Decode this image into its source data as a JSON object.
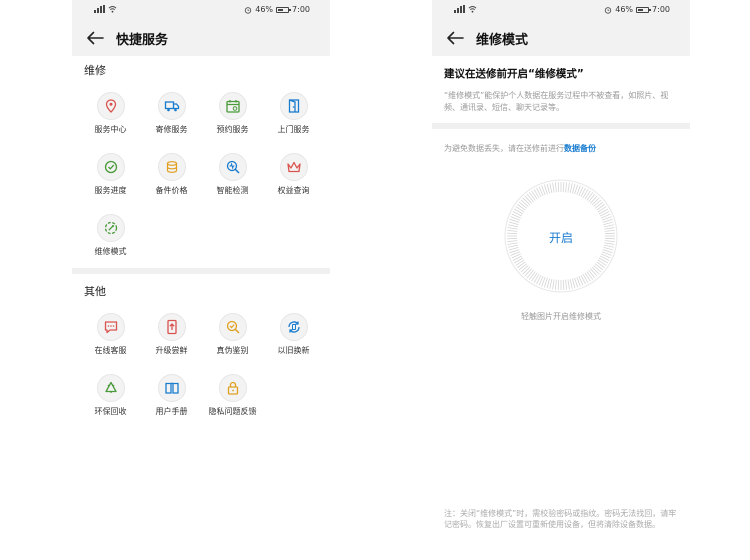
{
  "status_bar": {
    "battery": "46%",
    "time": "7:00"
  },
  "left_screen": {
    "title": "快捷服务",
    "sections": [
      {
        "label": "维修",
        "items": [
          {
            "label": "服务中心",
            "icon": "location-pin-icon",
            "color": "#d9534f"
          },
          {
            "label": "寄修服务",
            "icon": "truck-icon",
            "color": "#1a7ccf"
          },
          {
            "label": "预约服务",
            "icon": "calendar-icon",
            "color": "#4a9a3a"
          },
          {
            "label": "上门服务",
            "icon": "door-icon",
            "color": "#1a7ccf"
          },
          {
            "label": "服务进度",
            "icon": "progress-icon",
            "color": "#4a9a3a"
          },
          {
            "label": "备件价格",
            "icon": "coins-icon",
            "color": "#e0a020"
          },
          {
            "label": "智能检测",
            "icon": "detect-icon",
            "color": "#1a7ccf"
          },
          {
            "label": "权益查询",
            "icon": "crown-icon",
            "color": "#d9534f"
          },
          {
            "label": "维修模式",
            "icon": "repair-mode-icon",
            "color": "#4a9a3a"
          }
        ]
      },
      {
        "label": "其他",
        "items": [
          {
            "label": "在线客服",
            "icon": "chat-icon",
            "color": "#d9534f"
          },
          {
            "label": "升级尝鲜",
            "icon": "upgrade-icon",
            "color": "#d9534f"
          },
          {
            "label": "真伪鉴别",
            "icon": "authenticity-icon",
            "color": "#e0a020"
          },
          {
            "label": "以旧换新",
            "icon": "trade-in-icon",
            "color": "#1a7ccf"
          },
          {
            "label": "环保回收",
            "icon": "recycle-icon",
            "color": "#4a9a3a"
          },
          {
            "label": "用户手册",
            "icon": "book-icon",
            "color": "#1a7ccf"
          },
          {
            "label": "隐私问题反馈",
            "icon": "lock-icon",
            "color": "#e0a020"
          }
        ]
      }
    ]
  },
  "right_screen": {
    "title": "维修模式",
    "heading": "建议在送修前开启“维修模式”",
    "description": "“维修模式”能保护个人数据在服务过程中不被查看，如照片、视频、通讯录、短信、聊天记录等。",
    "backup_prefix": "为避免数据丢失，请在送修前进行",
    "backup_link": "数据备份",
    "dial_label": "开启",
    "hint": "轻触图片开启维修模式",
    "note": "注：关闭“维修模式”时，需校验密码或指纹。密码无法找回，请牢记密码。恢复出厂设置可重新使用设备，但将清除设备数据。"
  },
  "colors": {
    "accent_blue": "#1a7ccf",
    "red": "#d9534f",
    "green": "#4a9a3a",
    "orange": "#e0a020",
    "bar_bg": "#f2f2f2"
  }
}
